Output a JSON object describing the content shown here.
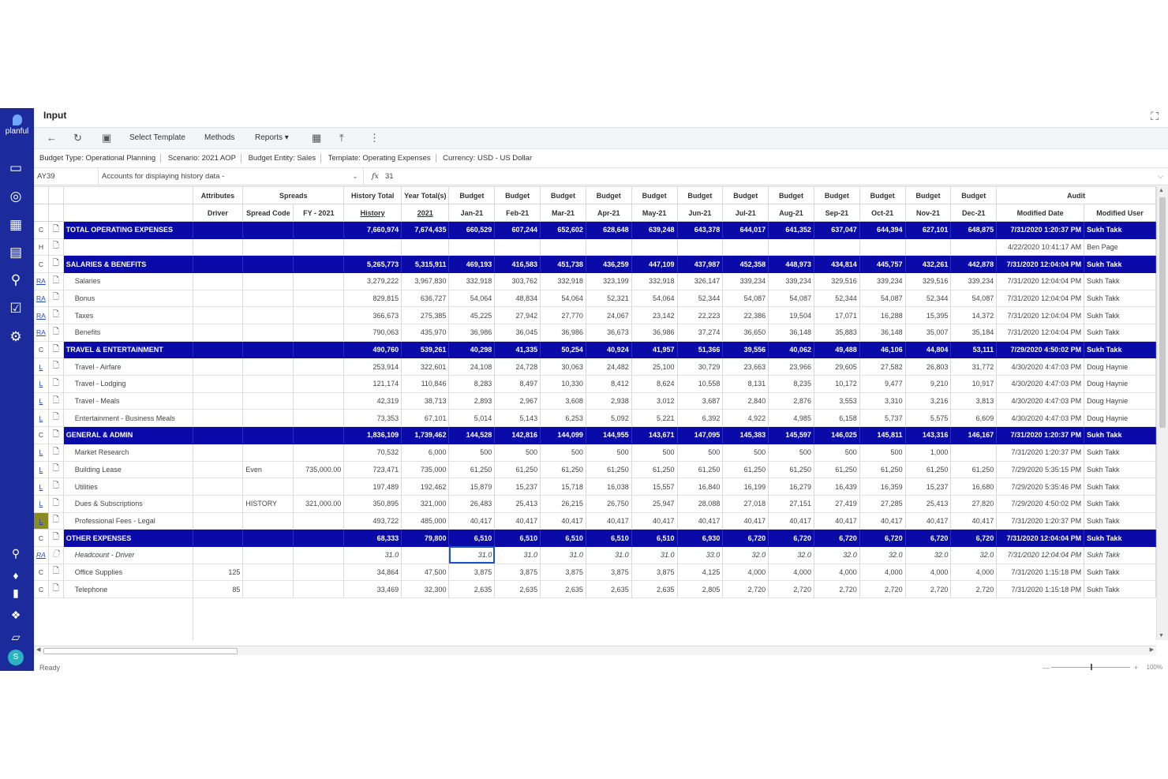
{
  "app": {
    "brand": "planful",
    "title": "Input"
  },
  "toolbar": {
    "select_template": "Select Template",
    "methods": "Methods",
    "reports": "Reports"
  },
  "info": {
    "budget_type": "Budget Type: Operational Planning",
    "scenario": "Scenario: 2021 AOP",
    "entity": "Budget Entity: Sales",
    "template": "Template: Operating Expenses",
    "currency": "Currency: USD - US Dollar"
  },
  "formula": {
    "cell_ref": "AY39",
    "dropdown": "Accounts for displaying history data -",
    "value": "31"
  },
  "header_groups": {
    "attributes": "Attributes",
    "spreads": "Spreads",
    "history_total": "History Total",
    "year_total": "Year Total(s)",
    "budget": "Budget",
    "audit": "Audit"
  },
  "header_cols": {
    "driver": "Driver",
    "spread_code": "Spread Code",
    "fy": "FY - 2021",
    "history": "History",
    "year": "2021",
    "months": [
      "Jan-21",
      "Feb-21",
      "Mar-21",
      "Apr-21",
      "May-21",
      "Jun-21",
      "Jul-21",
      "Aug-21",
      "Sep-21",
      "Oct-21",
      "Nov-21",
      "Dec-21"
    ],
    "modified_date": "Modified Date",
    "modified_user": "Modified User"
  },
  "rows": [
    {
      "type": "grp",
      "code": "C",
      "label": "TOTAL OPERATING EXPENSES",
      "driver": "",
      "spread": "",
      "fy": "",
      "hist": "7,660,974",
      "year": "7,674,435",
      "m": [
        "660,529",
        "607,244",
        "652,602",
        "628,648",
        "639,248",
        "643,378",
        "644,017",
        "641,352",
        "637,047",
        "644,394",
        "627,101",
        "648,875"
      ],
      "date": "7/31/2020 1:20:37 PM",
      "user": "Sukh Takk"
    },
    {
      "type": "item",
      "code": "H",
      "label": "",
      "driver": "",
      "spread": "",
      "fy": "",
      "hist": "",
      "year": "",
      "m": [
        "",
        "",
        "",
        "",
        "",
        "",
        "",
        "",
        "",
        "",
        "",
        ""
      ],
      "date": "4/22/2020 10:41:17 AM",
      "user": "Ben Page"
    },
    {
      "type": "grp",
      "code": "C",
      "label": "SALARIES & BENEFITS",
      "driver": "",
      "spread": "",
      "fy": "",
      "hist": "5,265,773",
      "year": "5,315,911",
      "m": [
        "469,193",
        "416,583",
        "451,738",
        "436,259",
        "447,109",
        "437,987",
        "452,358",
        "448,973",
        "434,814",
        "445,757",
        "432,261",
        "442,878"
      ],
      "date": "7/31/2020 12:04:04 PM",
      "user": "Sukh Takk"
    },
    {
      "type": "item",
      "code": "RA",
      "label": "Salaries",
      "driver": "",
      "spread": "",
      "fy": "",
      "hist": "3,279,222",
      "year": "3,967,830",
      "m": [
        "332,918",
        "303,762",
        "332,918",
        "323,199",
        "332,918",
        "326,147",
        "339,234",
        "339,234",
        "329,516",
        "339,234",
        "329,516",
        "339,234"
      ],
      "date": "7/31/2020 12:04:04 PM",
      "user": "Sukh Takk"
    },
    {
      "type": "item",
      "code": "RA",
      "label": "Bonus",
      "driver": "",
      "spread": "",
      "fy": "",
      "hist": "829,815",
      "year": "636,727",
      "m": [
        "54,064",
        "48,834",
        "54,064",
        "52,321",
        "54,064",
        "52,344",
        "54,087",
        "54,087",
        "52,344",
        "54,087",
        "52,344",
        "54,087"
      ],
      "date": "7/31/2020 12:04:04 PM",
      "user": "Sukh Takk"
    },
    {
      "type": "item",
      "code": "RA",
      "label": "Taxes",
      "driver": "",
      "spread": "",
      "fy": "",
      "hist": "366,673",
      "year": "275,385",
      "m": [
        "45,225",
        "27,942",
        "27,770",
        "24,067",
        "23,142",
        "22,223",
        "22,386",
        "19,504",
        "17,071",
        "16,288",
        "15,395",
        "14,372"
      ],
      "date": "7/31/2020 12:04:04 PM",
      "user": "Sukh Takk"
    },
    {
      "type": "item",
      "code": "RA",
      "label": "Benefits",
      "driver": "",
      "spread": "",
      "fy": "",
      "hist": "790,063",
      "year": "435,970",
      "m": [
        "36,986",
        "36,045",
        "36,986",
        "36,673",
        "36,986",
        "37,274",
        "36,650",
        "36,148",
        "35,883",
        "36,148",
        "35,007",
        "35,184"
      ],
      "date": "7/31/2020 12:04:04 PM",
      "user": "Sukh Takk"
    },
    {
      "type": "grp",
      "code": "C",
      "label": "TRAVEL & ENTERTAINMENT",
      "driver": "",
      "spread": "",
      "fy": "",
      "hist": "490,760",
      "year": "539,261",
      "m": [
        "40,298",
        "41,335",
        "50,254",
        "40,924",
        "41,957",
        "51,366",
        "39,556",
        "40,062",
        "49,488",
        "46,106",
        "44,804",
        "53,111"
      ],
      "date": "7/29/2020 4:50:02 PM",
      "user": "Sukh Takk"
    },
    {
      "type": "item",
      "code": "L",
      "label": "Travel - Airfare",
      "driver": "",
      "spread": "",
      "fy": "",
      "hist": "253,914",
      "year": "322,601",
      "m": [
        "24,108",
        "24,728",
        "30,063",
        "24,482",
        "25,100",
        "30,729",
        "23,663",
        "23,966",
        "29,605",
        "27,582",
        "26,803",
        "31,772"
      ],
      "date": "4/30/2020 4:47:03 PM",
      "user": "Doug Haynie"
    },
    {
      "type": "item",
      "code": "L",
      "label": "Travel - Lodging",
      "driver": "",
      "spread": "",
      "fy": "",
      "hist": "121,174",
      "year": "110,846",
      "m": [
        "8,283",
        "8,497",
        "10,330",
        "8,412",
        "8,624",
        "10,558",
        "8,131",
        "8,235",
        "10,172",
        "9,477",
        "9,210",
        "10,917"
      ],
      "date": "4/30/2020 4:47:03 PM",
      "user": "Doug Haynie"
    },
    {
      "type": "item",
      "code": "L",
      "label": "Travel - Meals",
      "driver": "",
      "spread": "",
      "fy": "",
      "hist": "42,319",
      "year": "38,713",
      "m": [
        "2,893",
        "2,967",
        "3,608",
        "2,938",
        "3,012",
        "3,687",
        "2,840",
        "2,876",
        "3,553",
        "3,310",
        "3,216",
        "3,813"
      ],
      "date": "4/30/2020 4:47:03 PM",
      "user": "Doug Haynie"
    },
    {
      "type": "item",
      "code": "L",
      "label": "Entertainment - Business Meals",
      "driver": "",
      "spread": "",
      "fy": "",
      "hist": "73,353",
      "year": "67,101",
      "m": [
        "5,014",
        "5,143",
        "6,253",
        "5,092",
        "5,221",
        "6,392",
        "4,922",
        "4,985",
        "6,158",
        "5,737",
        "5,575",
        "6,609"
      ],
      "date": "4/30/2020 4:47:03 PM",
      "user": "Doug Haynie"
    },
    {
      "type": "grp",
      "code": "C",
      "label": "GENERAL & ADMIN",
      "driver": "",
      "spread": "",
      "fy": "",
      "hist": "1,836,109",
      "year": "1,739,462",
      "m": [
        "144,528",
        "142,816",
        "144,099",
        "144,955",
        "143,671",
        "147,095",
        "145,383",
        "145,597",
        "146,025",
        "145,811",
        "143,316",
        "146,167"
      ],
      "date": "7/31/2020 1:20:37 PM",
      "user": "Sukh Takk"
    },
    {
      "type": "item",
      "code": "L",
      "label": "Market Research",
      "driver": "",
      "spread": "",
      "fy": "",
      "hist": "70,532",
      "year": "6,000",
      "m": [
        "500",
        "500",
        "500",
        "500",
        "500",
        "500",
        "500",
        "500",
        "500",
        "500",
        "1,000",
        ""
      ],
      "date": "7/31/2020 1:20:37 PM",
      "user": "Sukh Takk"
    },
    {
      "type": "item",
      "code": "L",
      "label": "Building Lease",
      "driver": "",
      "spread": "Even",
      "fy": "735,000.00",
      "hist": "723,471",
      "year": "735,000",
      "m": [
        "61,250",
        "61,250",
        "61,250",
        "61,250",
        "61,250",
        "61,250",
        "61,250",
        "61,250",
        "61,250",
        "61,250",
        "61,250",
        "61,250"
      ],
      "date": "7/29/2020 5:35:15 PM",
      "user": "Sukh Takk"
    },
    {
      "type": "item",
      "code": "L",
      "label": "Utilities",
      "driver": "",
      "spread": "",
      "fy": "",
      "hist": "197,489",
      "year": "192,462",
      "m": [
        "15,879",
        "15,237",
        "15,718",
        "16,038",
        "15,557",
        "16,840",
        "16,199",
        "16,279",
        "16,439",
        "16,359",
        "15,237",
        "16,680"
      ],
      "date": "7/29/2020 5:35:46 PM",
      "user": "Sukh Takk"
    },
    {
      "type": "item",
      "code": "L",
      "label": "Dues & Subscriptions",
      "driver": "",
      "spread": "HISTORY",
      "fy": "321,000.00",
      "hist": "350,895",
      "year": "321,000",
      "m": [
        "26,483",
        "25,413",
        "26,215",
        "26,750",
        "25,947",
        "28,088",
        "27,018",
        "27,151",
        "27,419",
        "27,285",
        "25,413",
        "27,820"
      ],
      "date": "7/29/2020 4:50:02 PM",
      "user": "Sukh Takk"
    },
    {
      "type": "item",
      "code": "L",
      "label": "Professional Fees - Legal",
      "driver": "",
      "spread": "",
      "fy": "",
      "hist": "493,722",
      "year": "485,000",
      "m": [
        "40,417",
        "40,417",
        "40,417",
        "40,417",
        "40,417",
        "40,417",
        "40,417",
        "40,417",
        "40,417",
        "40,417",
        "40,417",
        "40,417"
      ],
      "date": "7/31/2020 1:20:37 PM",
      "user": "Sukh Takk",
      "yellow": true
    },
    {
      "type": "grp",
      "code": "C",
      "label": "OTHER EXPENSES",
      "driver": "",
      "spread": "",
      "fy": "",
      "hist": "68,333",
      "year": "79,800",
      "m": [
        "6,510",
        "6,510",
        "6,510",
        "6,510",
        "6,510",
        "6,930",
        "6,720",
        "6,720",
        "6,720",
        "6,720",
        "6,720",
        "6,720"
      ],
      "date": "7/31/2020 12:04:04 PM",
      "user": "Sukh Takk"
    },
    {
      "type": "italic",
      "code": "RA",
      "label": "Headcount - Driver",
      "driver": "",
      "spread": "",
      "fy": "",
      "hist": "31.0",
      "year": "",
      "m": [
        "31.0",
        "31.0",
        "31.0",
        "31.0",
        "31.0",
        "33.0",
        "32.0",
        "32.0",
        "32.0",
        "32.0",
        "32.0",
        "32.0"
      ],
      "date": "7/31/2020 12:04:04 PM",
      "user": "Sukh Takk",
      "selected": 0
    },
    {
      "type": "item",
      "code": "C",
      "label": "Office Supplies",
      "driver": "125",
      "spread": "",
      "fy": "",
      "hist": "34,864",
      "year": "47,500",
      "m": [
        "3,875",
        "3,875",
        "3,875",
        "3,875",
        "3,875",
        "4,125",
        "4,000",
        "4,000",
        "4,000",
        "4,000",
        "4,000",
        "4,000"
      ],
      "date": "7/31/2020 1:15:18 PM",
      "user": "Sukh Takk"
    },
    {
      "type": "item",
      "code": "C",
      "label": "Telephone",
      "driver": "85",
      "spread": "",
      "fy": "",
      "hist": "33,469",
      "year": "32,300",
      "m": [
        "2,635",
        "2,635",
        "2,635",
        "2,635",
        "2,635",
        "2,805",
        "2,720",
        "2,720",
        "2,720",
        "2,720",
        "2,720",
        "2,720"
      ],
      "date": "7/31/2020 1:15:18 PM",
      "user": "Sukh Takk"
    }
  ],
  "status": {
    "text": "Ready",
    "zoom": "100%"
  },
  "colors": {
    "rail": "#1b2b9b",
    "group_row": "#0a0aa8",
    "selection": "#1a56c7"
  }
}
